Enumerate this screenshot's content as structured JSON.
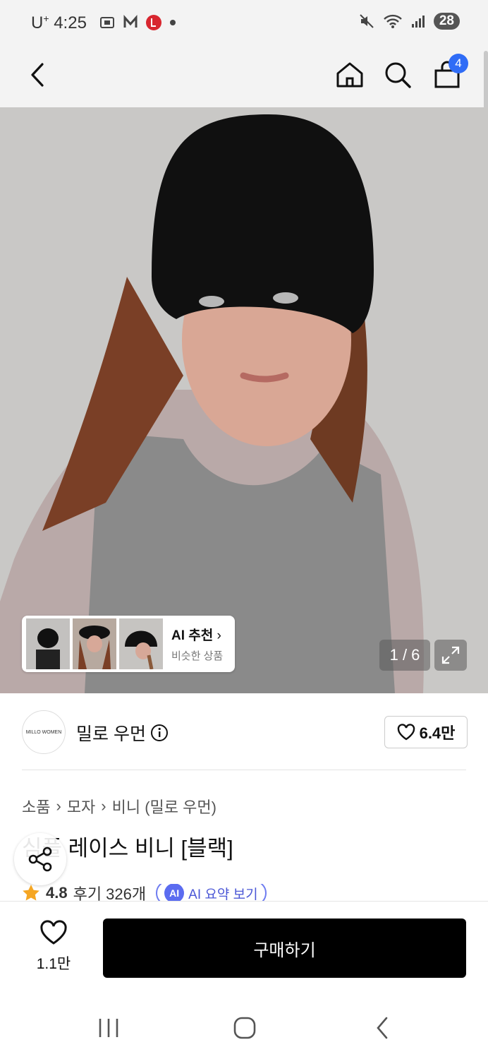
{
  "status_bar": {
    "carrier": "U",
    "carrier_sup": "+",
    "time": "4:25",
    "notif_icons": [
      "screen-record-icon",
      "m-app-icon",
      "l-app-icon",
      "dot-icon"
    ],
    "battery": "28"
  },
  "header": {
    "back_icon": "chevron-left-icon",
    "home_icon": "home-icon",
    "search_icon": "search-icon",
    "cart_icon": "shopping-bag-icon",
    "cart_count": "4"
  },
  "hero": {
    "image": "product-photo",
    "ai_reco_title": "AI 추천",
    "ai_reco_sub": "비슷한 상품",
    "pager": "1 / 6",
    "expand_icon": "expand-icon"
  },
  "brand": {
    "logo_text": "MILLO WOMEN",
    "name": "밀로 우먼",
    "likes": "6.4만"
  },
  "breadcrumbs": [
    "소품",
    "모자",
    "비니 (밀로 우먼)"
  ],
  "product": {
    "title": "심플 레이스 비니 [블랙]",
    "rating": "4.8",
    "reviews": "후기 326개",
    "ai_summary": "AI 요약 보기",
    "ai_badge": "AI"
  },
  "bottom_bar": {
    "wish_count": "1.1만",
    "buy_label": "구매하기"
  },
  "colors": {
    "accent_blue": "#2f6cf6",
    "ai_purple": "#5b6cf0",
    "buy_bg": "#000000"
  }
}
